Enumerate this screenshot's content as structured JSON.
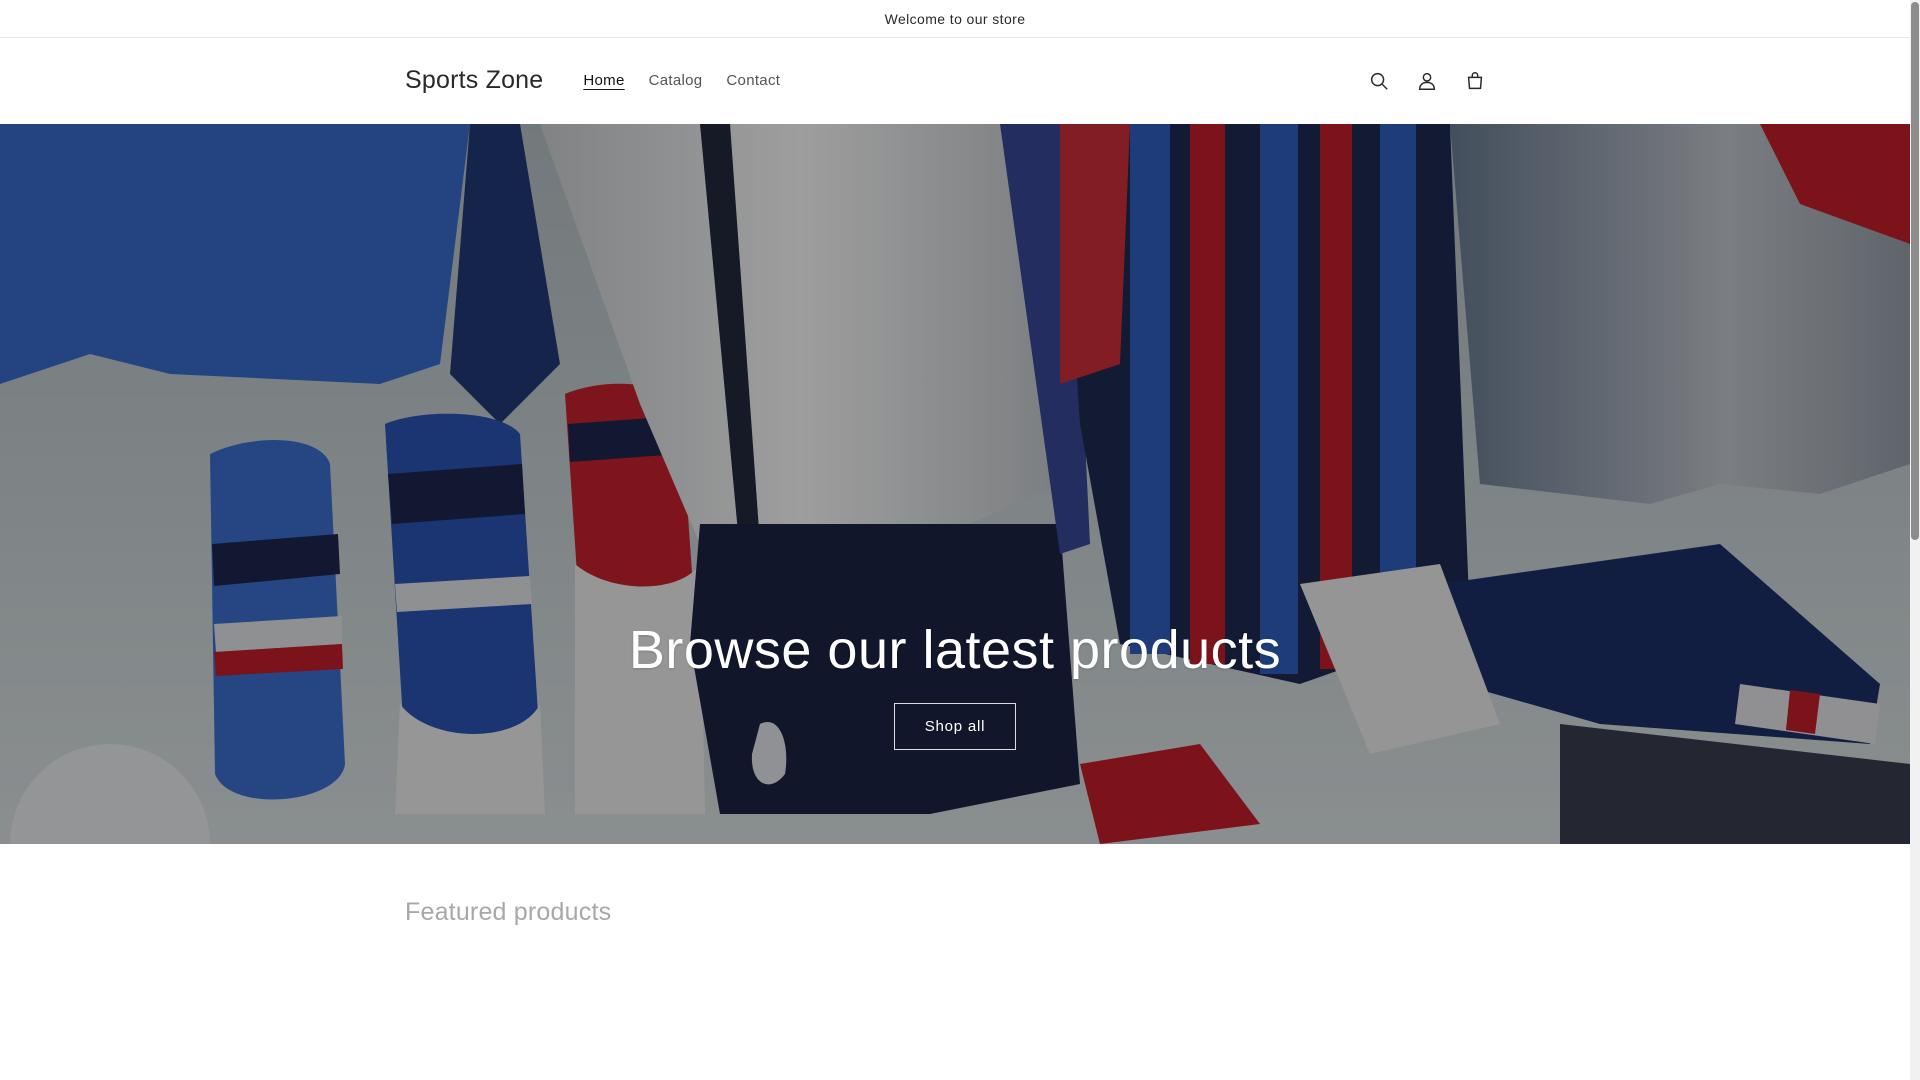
{
  "announcement": {
    "text": "Welcome to our store"
  },
  "header": {
    "logo": "Sports Zone",
    "nav": [
      {
        "label": "Home",
        "active": true
      },
      {
        "label": "Catalog",
        "active": false
      },
      {
        "label": "Contact",
        "active": false
      }
    ],
    "icons": [
      "search-icon",
      "account-icon",
      "cart-icon"
    ]
  },
  "hero": {
    "title": "Browse our latest products",
    "button_label": "Shop all"
  },
  "featured": {
    "title": "Featured products"
  },
  "colors": {
    "overlay": "#000000",
    "text": "#121212",
    "muted_heading": "#a8a8a8",
    "jersey_red": "#d0212e",
    "jersey_blue": "#2f62c4",
    "jersey_navy": "#1e2a55"
  }
}
